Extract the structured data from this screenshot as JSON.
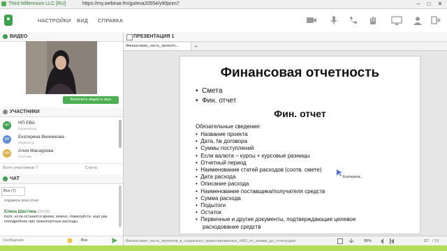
{
  "browser": {
    "title": "Third Millennium LLC [RU]",
    "url": "https://my.webinar.fm/go/eva20554/y90pnm7",
    "win_min": "–",
    "win_max": "□",
    "win_close": "✕"
  },
  "menu": [
    "НАСТРОЙКИ",
    "ВИД",
    "СПРАВКА"
  ],
  "video_panel": {
    "title": "ВИДЕО",
    "enable_button": "Включить видео и звук"
  },
  "participants": {
    "title": "УЧАСТНИКИ",
    "list": [
      {
        "initials": "НП",
        "name": "НП ЕВА",
        "role": "Организатор",
        "color": "#3aa24a"
      },
      {
        "initials": "ЕВ",
        "name": "Екатерина Винникова",
        "role": "Модератор",
        "color": "#5b8ed6"
      },
      {
        "initials": "АМ",
        "name": "Алия Масаурова",
        "role": "Участник",
        "color": "#e0b04a"
      }
    ],
    "total_label": "Всего участников: 7",
    "status_label": "Статус"
  },
  "chat": {
    "title": "ЧАТ",
    "filter": "Все (7)",
    "prev_tail": "подавать мои отчет",
    "author": "Елена Шастина",
    "time": "(19:05)",
    "message": "Катя, если останется время, можно, пожалуйста, ещё раз поподробнее про транспортные расходы.",
    "input_label": "Сообщение",
    "scope": "Все"
  },
  "presentation": {
    "panel_title": "ПРЕЗЕНТАЦИЯ 1",
    "tab_label": "Финансовая_часть_проекто...",
    "tab_add": "+",
    "slide": {
      "title": "Финансовая отчетность",
      "bullets": [
        "Смета",
        "Фин. отчет"
      ],
      "subtitle": "Фин. отчет",
      "intro": "Обязательные сведения:",
      "items": [
        "Название проекта",
        "Дата, № договора",
        "Суммы поступлений",
        "Если валюта – курсы + курсовые разницы",
        "Отчетный период",
        "Наименование статей расходов (соотв. смете)",
        "Дата расхода",
        "Описание расхода",
        "Наименование поставщика/получателя средств",
        "Сумма расхода",
        "Подытоги",
        "Остаток",
        "Первичные и другие документы, подтверждающие целевое",
        "расходование средств"
      ]
    },
    "pointer_label": "Екатерина...",
    "file_name": "Финансовая_часть_проектов_в_социально_ориентированных_НКО_от_заявки_до_отчета.pptx",
    "zoom": "95%",
    "page": "17",
    "page_total": "/ 19"
  }
}
